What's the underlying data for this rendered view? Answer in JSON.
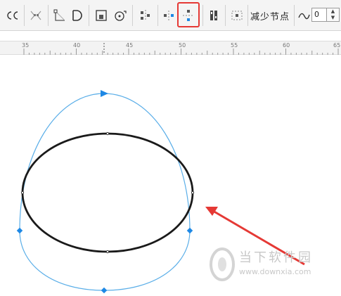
{
  "toolbar": {
    "buttons": [
      {
        "name": "break-curve-icon"
      },
      {
        "name": "join-nodes-icon"
      },
      {
        "name": "to-line-icon"
      },
      {
        "name": "to-curve-icon"
      },
      {
        "name": "extract-subpath-icon"
      },
      {
        "name": "rotate-nodes-icon"
      },
      {
        "name": "align-nodes-icon"
      },
      {
        "name": "horizontal-reflect-icon"
      },
      {
        "name": "vertical-reflect-icon"
      },
      {
        "name": "elastic-mode-icon"
      },
      {
        "name": "select-all-nodes-icon"
      }
    ],
    "reduce_nodes_label": "减少节点",
    "smoothness_value": "0",
    "highlight_color": "#e53935"
  },
  "ruler": {
    "labels": [
      "35",
      "40",
      "45",
      "50",
      "55",
      "60",
      "65"
    ]
  },
  "canvas": {
    "ellipse_color": "#1a1a1a",
    "curve_color": "#5aaee8",
    "node_color": "#1e88e5",
    "arrow_color": "#e53935"
  },
  "watermark": {
    "title": "当下软件园",
    "url": "www.downxia.com"
  }
}
